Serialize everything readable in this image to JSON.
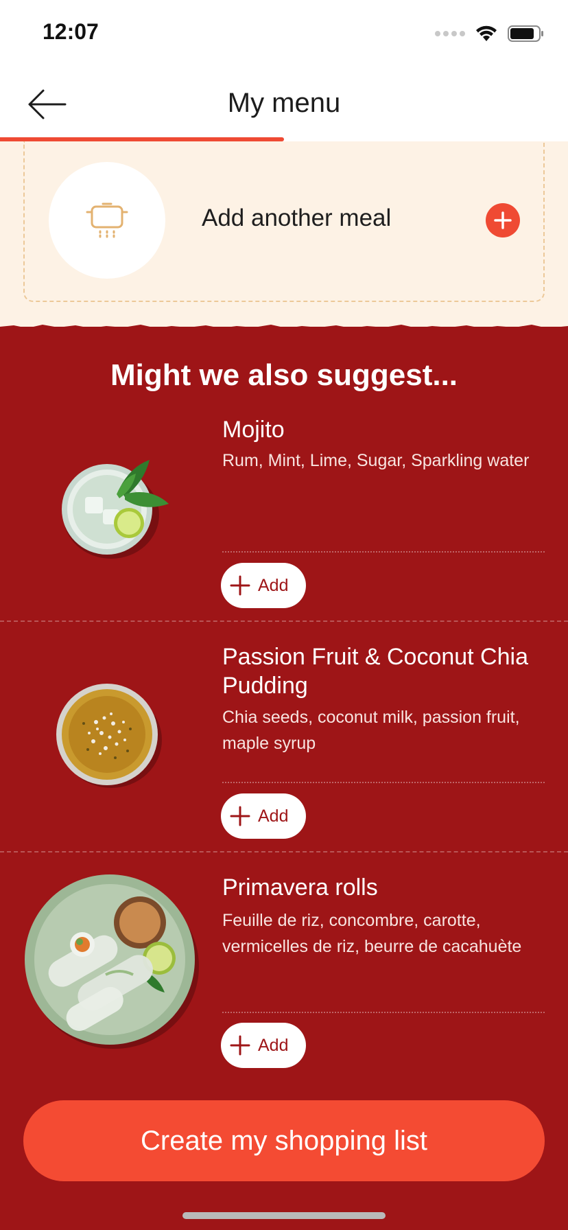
{
  "status_bar": {
    "time": "12:07"
  },
  "header": {
    "title": "My menu",
    "progress_fraction": 0.5
  },
  "add_meal": {
    "label": "Add another meal"
  },
  "suggestions": {
    "title": "Might we also suggest...",
    "items": [
      {
        "name": "Mojito",
        "description": "Rum, Mint, Lime, Sugar, Sparkling water",
        "add_label": "Add"
      },
      {
        "name": "Passion Fruit & Coconut Chia Pudding",
        "description": "Chia seeds, coconut milk, passion fruit, maple syrup",
        "add_label": "Add"
      },
      {
        "name": "Primavera rolls",
        "description": "Feuille de riz, concombre, carotte, vermicelles de riz, beurre de cacahuète",
        "add_label": "Add"
      }
    ]
  },
  "cta": {
    "label": "Create my shopping list"
  },
  "colors": {
    "brand_red": "#9e1517",
    "accent_orange": "#ef4a33",
    "cream": "#fdf2e5"
  },
  "icons": [
    "back-arrow-icon",
    "pot-icon",
    "plus-icon",
    "wifi-icon",
    "battery-icon",
    "signal-icon"
  ]
}
